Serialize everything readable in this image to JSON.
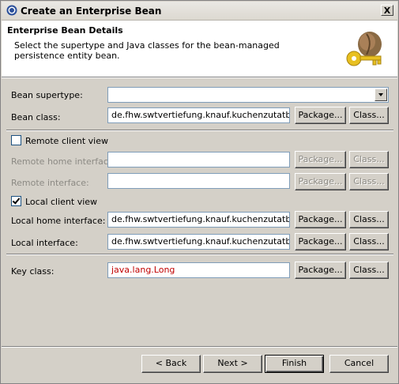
{
  "window": {
    "title": "Create an Enterprise Bean",
    "close_glyph": "X"
  },
  "banner": {
    "title": "Enterprise Bean Details",
    "description": "Select the supertype and Java classes for the bean-managed persistence entity bean."
  },
  "form": {
    "supertype": {
      "label": "Bean supertype:",
      "value": ""
    },
    "bean_class": {
      "label": "Bean class:",
      "value": "de.fhw.swtvertiefung.knauf.kuchenzutatbmp."
    },
    "remote_view": {
      "label": "Remote client view",
      "checked": false
    },
    "remote_home": {
      "label": "Remote home interface:",
      "value": ""
    },
    "remote_interface": {
      "label": "Remote interface:",
      "value": ""
    },
    "local_view": {
      "label": "Local client view",
      "checked": true
    },
    "local_home": {
      "label": "Local home interface:",
      "value": "de.fhw.swtvertiefung.knauf.kuchenzutatbmp."
    },
    "local_interface": {
      "label": "Local interface:",
      "value": "de.fhw.swtvertiefung.knauf.kuchenzutatbmp."
    },
    "key_class": {
      "label": "Key class:",
      "value": "java.lang.Long"
    },
    "package_label": "Package...",
    "class_label": "Class..."
  },
  "footer": {
    "back_label": "< Back",
    "next_label": "Next >",
    "finish_label": "Finish",
    "cancel_label": "Cancel"
  },
  "colors": {
    "key_class_text": "#c00000",
    "disabled_text": "#8c8a84",
    "dialog_bg": "#d4d0c8"
  }
}
